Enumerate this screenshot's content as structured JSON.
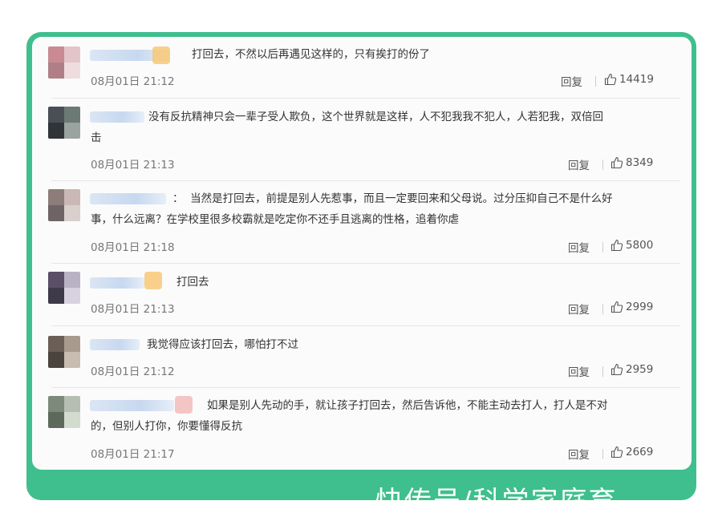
{
  "comments": [
    {
      "text": "打回去，不然以后再遇见这样的，只有挨打的份了",
      "time": "08月01日 21:12",
      "reply": "回复",
      "likes": "14419",
      "avatar_colors": [
        "#c98a93",
        "#e4c5c7",
        "#b07f86",
        "#efdcde"
      ]
    },
    {
      "text": "没有反抗精神只会一辈子受人欺负，这个世界就是这样，人不犯我我不犯人，人若犯我，双倍回\n击",
      "time": "08月01日 21:13",
      "reply": "回复",
      "likes": "8349",
      "avatar_colors": [
        "#4a4f55",
        "#6b7a74",
        "#2f3438",
        "#9aa3a0"
      ]
    },
    {
      "text": "：  当然是打回去，前提是别人先惹事，而且一定要回来和父母说。过分压抑自己不是什么好\n事，什么远离？在学校里很多校霸就是吃定你不还手且逃离的性格，追着你虐",
      "time": "08月01日 21:18",
      "reply": "回复",
      "likes": "5800",
      "avatar_colors": [
        "#8c7d7a",
        "#c9b8b4",
        "#6e6466",
        "#d9cfcc"
      ]
    },
    {
      "text": "打回去",
      "time": "08月01日 21:13",
      "reply": "回复",
      "likes": "2999",
      "avatar_colors": [
        "#5a4f66",
        "#b9b2c4",
        "#3e3a4a",
        "#d8d2e0"
      ]
    },
    {
      "text": "我觉得应该打回去，哪怕打不过",
      "time": "08月01日 21:12",
      "reply": "回复",
      "likes": "2959",
      "avatar_colors": [
        "#6a5e56",
        "#a89a8c",
        "#4b433d",
        "#c8bcb1"
      ]
    },
    {
      "text": "如果是别人先动的手，就让孩子打回去，然后告诉他，不能主动去打人，打人是不对\n的，但别人打你，你要懂得反抗",
      "time": "08月01日 21:17",
      "reply": "回复",
      "likes": "2669",
      "avatar_colors": [
        "#7d8a7a",
        "#b5bfb1",
        "#5d6a5b",
        "#d3dacf"
      ]
    }
  ],
  "watermark": "快传号/科学家庭育"
}
